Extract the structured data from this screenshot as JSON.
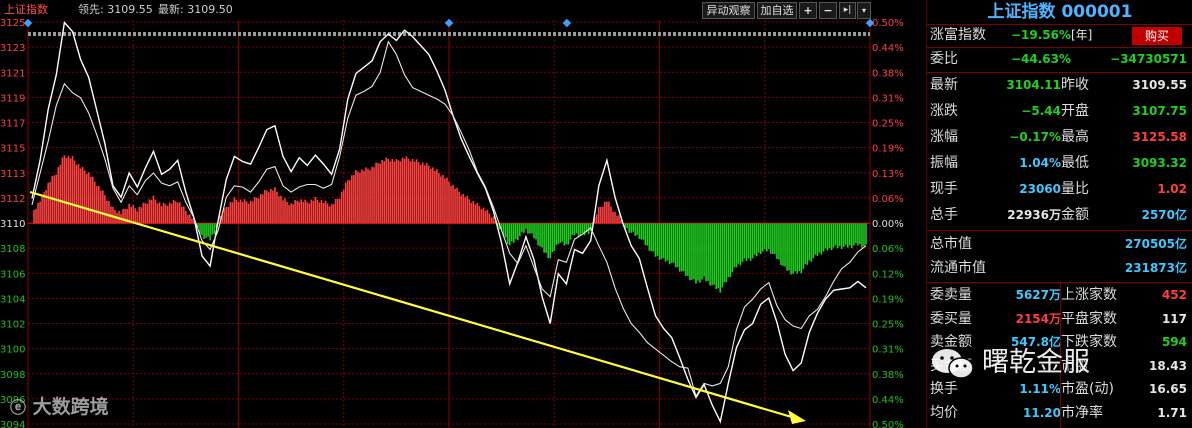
{
  "header": {
    "index_name": "上证指数",
    "lead_label": "领先:",
    "lead_value": "3109.55",
    "latest_label": "最新:",
    "latest_value": "3109.50"
  },
  "toolbar": {
    "watch_label": "异动观察",
    "add_label": "加自选",
    "zoom_in": "+",
    "zoom_out": "−",
    "end_label": "▸|",
    "menu_label": "▾"
  },
  "axis": {
    "left_ticks": [
      "3125",
      "3123",
      "3121",
      "3119",
      "3117",
      "3115",
      "3113",
      "3112",
      "3110",
      "3108",
      "3106",
      "3104",
      "3102",
      "3100",
      "3098",
      "3096",
      "3094"
    ],
    "right_ticks": [
      "0.50%",
      "0.44%",
      "0.38%",
      "0.31%",
      "0.25%",
      "0.19%",
      "0.13%",
      "0.06%",
      "0.00%",
      "0.06%",
      "0.12%",
      "0.19%",
      "0.25%",
      "0.31%",
      "0.38%",
      "0.44%",
      "0.50%"
    ]
  },
  "chart_data": {
    "type": "line",
    "prev_close": 3109.55,
    "ylim": [
      3093.5,
      3125.5
    ],
    "series": [
      {
        "values": [
          3111.5,
          3114.5,
          3118.5,
          3121.2,
          3125.3,
          3124.6,
          3122.4,
          3121.0,
          3118.4,
          3115.8,
          3112.5,
          3111.6,
          3113.5,
          3112.4,
          3113.9,
          3115.2,
          3113.4,
          3113.8,
          3114.5,
          3112.0,
          3110.0,
          3107.0,
          3106.2,
          3109.8,
          3113.0,
          3114.8,
          3114.4,
          3114.2,
          3115.5,
          3116.9,
          3117.2,
          3114.8,
          3113.6,
          3114.7,
          3114.1,
          3114.9,
          3114.2,
          3113.4,
          3115.4,
          3119.3,
          3121.3,
          3121.8,
          3122.3,
          3123.8,
          3124.4,
          3123.9,
          3124.7,
          3124.2,
          3123.5,
          3122.8,
          3121.5,
          3120.0,
          3118.0,
          3116.2,
          3114.8,
          3113.5,
          3112.3,
          3110.5,
          3108.0,
          3104.8,
          3106.5,
          3108.5,
          3106.7,
          3103.8,
          3101.7,
          3105.6,
          3104.8,
          3107.5,
          3107.2,
          3108.2,
          3112.5,
          3114.5,
          3111.6,
          3109.5,
          3107.8,
          3106.8,
          3104.5,
          3102.3,
          3101.3,
          3100.6,
          3099.0,
          3097.3,
          3095.9,
          3096.9,
          3095.3,
          3094.0,
          3097.0,
          3099.8,
          3101.2,
          3101.7,
          3103.2,
          3103.7,
          3101.8,
          3099.3,
          3098.0,
          3098.6,
          3101.0,
          3102.5,
          3103.6,
          3104.3,
          3104.4,
          3104.5,
          3105.0,
          3104.5
        ]
      },
      {
        "values": [
          3111.0,
          3113.5,
          3116.0,
          3118.8,
          3120.5,
          3119.8,
          3119.4,
          3118.2,
          3116.5,
          3114.6,
          3112.3,
          3111.2,
          3112.5,
          3111.8,
          3112.9,
          3113.5,
          3112.7,
          3112.5,
          3112.8,
          3111.2,
          3110.0,
          3108.2,
          3107.5,
          3109.0,
          3111.6,
          3112.5,
          3112.4,
          3112.0,
          3112.8,
          3113.8,
          3114.0,
          3112.5,
          3112.0,
          3112.4,
          3112.6,
          3112.6,
          3112.3,
          3112.6,
          3114.8,
          3117.8,
          3119.6,
          3119.9,
          3120.3,
          3121.4,
          3123.8,
          3122.8,
          3121.2,
          3120.2,
          3119.9,
          3119.6,
          3119.3,
          3118.9,
          3118.0,
          3116.7,
          3115.3,
          3113.6,
          3112.4,
          3110.8,
          3109.0,
          3107.2,
          3106.4,
          3107.8,
          3106.1,
          3104.4,
          3103.8,
          3106.7,
          3106.5,
          3108.3,
          3108.7,
          3109.2,
          3107.8,
          3106.5,
          3104.5,
          3102.9,
          3101.7,
          3101.0,
          3100.2,
          3099.7,
          3099.2,
          3098.7,
          3098.3,
          3098.2,
          3096.0,
          3097.0,
          3096.8,
          3097.0,
          3098.3,
          3101.2,
          3103.0,
          3103.6,
          3104.4,
          3104.9,
          3103.1,
          3102.0,
          3101.5,
          3101.3,
          3102.3,
          3102.8,
          3103.8,
          3105.0,
          3106.0,
          3106.5,
          3107.3,
          3107.8
        ]
      }
    ]
  },
  "side": {
    "title": "上证指数 000001",
    "row1": {
      "label": "涨富指数",
      "value": "−19.56%",
      "suffix": "[年]",
      "button": "购买"
    },
    "row2": {
      "label": "委比",
      "value1": "−44.63%",
      "value2": "−34730571"
    },
    "grid": [
      {
        "l1": "最新",
        "v1": "3104.11",
        "c1": "green",
        "l2": "昨收",
        "v2": "3109.55",
        "c2": "white"
      },
      {
        "l1": "涨跌",
        "v1": "−5.44",
        "c1": "green",
        "l2": "开盘",
        "v2": "3107.75",
        "c2": "green"
      },
      {
        "l1": "涨幅",
        "v1": "−0.17%",
        "c1": "green",
        "l2": "最高",
        "v2": "3125.58",
        "c2": "red"
      },
      {
        "l1": "振幅",
        "v1": "1.04%",
        "c1": "cyan",
        "l2": "最低",
        "v2": "3093.32",
        "c2": "green"
      },
      {
        "l1": "现手",
        "v1": "23060",
        "c1": "cyan",
        "l2": "量比",
        "v2": "1.02",
        "c2": "red"
      },
      {
        "l1": "总手",
        "v1": "22936万",
        "c1": "white",
        "l2": "金额",
        "v2": "2570亿",
        "c2": "cyan"
      }
    ],
    "mkt": [
      {
        "label": "总市值",
        "value": "270505亿"
      },
      {
        "label": "流通市值",
        "value": "231873亿"
      }
    ],
    "lower": [
      {
        "l1": "委卖量",
        "v1": "5627万",
        "c1": "cyan",
        "l2": "上涨家数",
        "v2": "452",
        "c2": "red"
      },
      {
        "l1": "委买量",
        "v1": "2154万",
        "c1": "red",
        "l2": "平盘家数",
        "v2": "117",
        "c2": "white"
      },
      {
        "l1": "卖金额",
        "v1": "547.8亿",
        "c1": "cyan",
        "l2": "下跌家数",
        "v2": "594",
        "c2": "green"
      },
      {
        "l1": "买金额",
        "v1": "",
        "c1": "white",
        "l2": "市盈",
        "v2": "18.43",
        "c2": "white"
      },
      {
        "l1": "换手",
        "v1": "1.11%",
        "c1": "cyan",
        "l2": "市盈(动)",
        "v2": "16.65",
        "c2": "white"
      },
      {
        "l1": "均价",
        "v1": "11.20",
        "c1": "cyan",
        "l2": "市净率",
        "v2": "1.71",
        "c2": "white"
      }
    ]
  },
  "watermarks": {
    "left": "大数跨境",
    "right": "曙乾金服"
  },
  "colors": {
    "up": "#ff4040",
    "down": "#20d020",
    "grid": "#7a0000",
    "trend": "#ffff40"
  }
}
